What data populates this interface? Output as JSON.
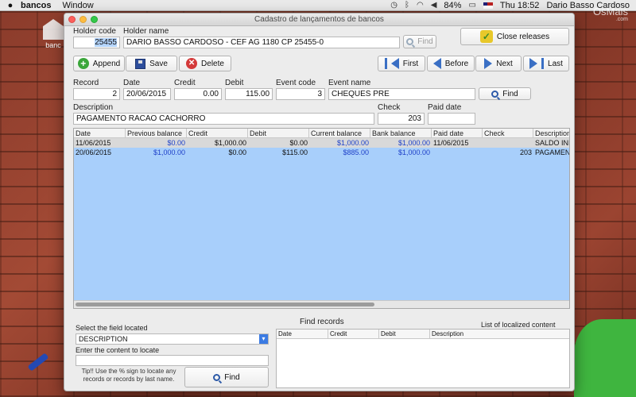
{
  "menubar": {
    "app_name": "bancos",
    "menus": [
      "Window"
    ],
    "battery": "84%",
    "clock": "Thu 18:52",
    "user": "Dario Basso Cardoso"
  },
  "desktop": {
    "icon_label": "banc",
    "brand_logo": "OsMais",
    "brand_sub": ".com"
  },
  "window": {
    "title": "Cadastro de lançamentos de bancos"
  },
  "holder": {
    "code_label": "Holder code",
    "code_value": "25455",
    "name_label": "Holder name",
    "name_value": "DARIO BASSO CARDOSO - CEF AG 1180 CP 25455-0",
    "find_label": "Find",
    "close_releases_label": "Close releases"
  },
  "toolbar": {
    "append_label": "Append",
    "save_label": "Save",
    "delete_label": "Delete",
    "first_label": "First",
    "before_label": "Before",
    "next_label": "Next",
    "last_label": "Last"
  },
  "record": {
    "record_label": "Record",
    "record_value": "2",
    "date_label": "Date",
    "date_value": "20/06/2015",
    "credit_label": "Credit",
    "credit_value": "0.00",
    "debit_label": "Debit",
    "debit_value": "115.00",
    "event_code_label": "Event code",
    "event_code_value": "3",
    "event_name_label": "Event name",
    "event_name_value": "CHEQUES PRE",
    "event_find_label": "Find",
    "description_label": "Description",
    "description_value": "PAGAMENTO RACAO CACHORRO",
    "check_label": "Check",
    "check_value": "203",
    "paid_date_label": "Paid date",
    "paid_date_value": ""
  },
  "grid": {
    "columns": [
      "Date",
      "Previous balance",
      "Credit",
      "Debit",
      "Current balance",
      "Bank balance",
      "Paid date",
      "Check",
      "Description"
    ],
    "rows": [
      [
        "11/06/2015",
        "$0.00",
        "$1,000.00",
        "$0.00",
        "$1,000.00",
        "$1,000.00",
        "11/06/2015",
        "",
        "SALDO INIC"
      ],
      [
        "20/06/2015",
        "$1,000.00",
        "$0.00",
        "$115.00",
        "$885.00",
        "$1,000.00",
        "",
        "203",
        "PAGAMENT"
      ]
    ]
  },
  "search_panel": {
    "field_label": "Select the field located",
    "field_value": "DESCRIPTION",
    "content_label": "Enter the content to locate",
    "content_value": "",
    "tip_line1": "Tip!! Use the % sign to locate any",
    "tip_line2": "records or records by last name.",
    "find_label": "Find",
    "find_records_title": "Find records",
    "localized_title": "List of localized content",
    "result_columns": [
      "Date",
      "Credit",
      "Debit",
      "Description"
    ]
  },
  "colors": {
    "grid_selection": "#a8cffb",
    "money_blue": "#1d3fc8"
  }
}
